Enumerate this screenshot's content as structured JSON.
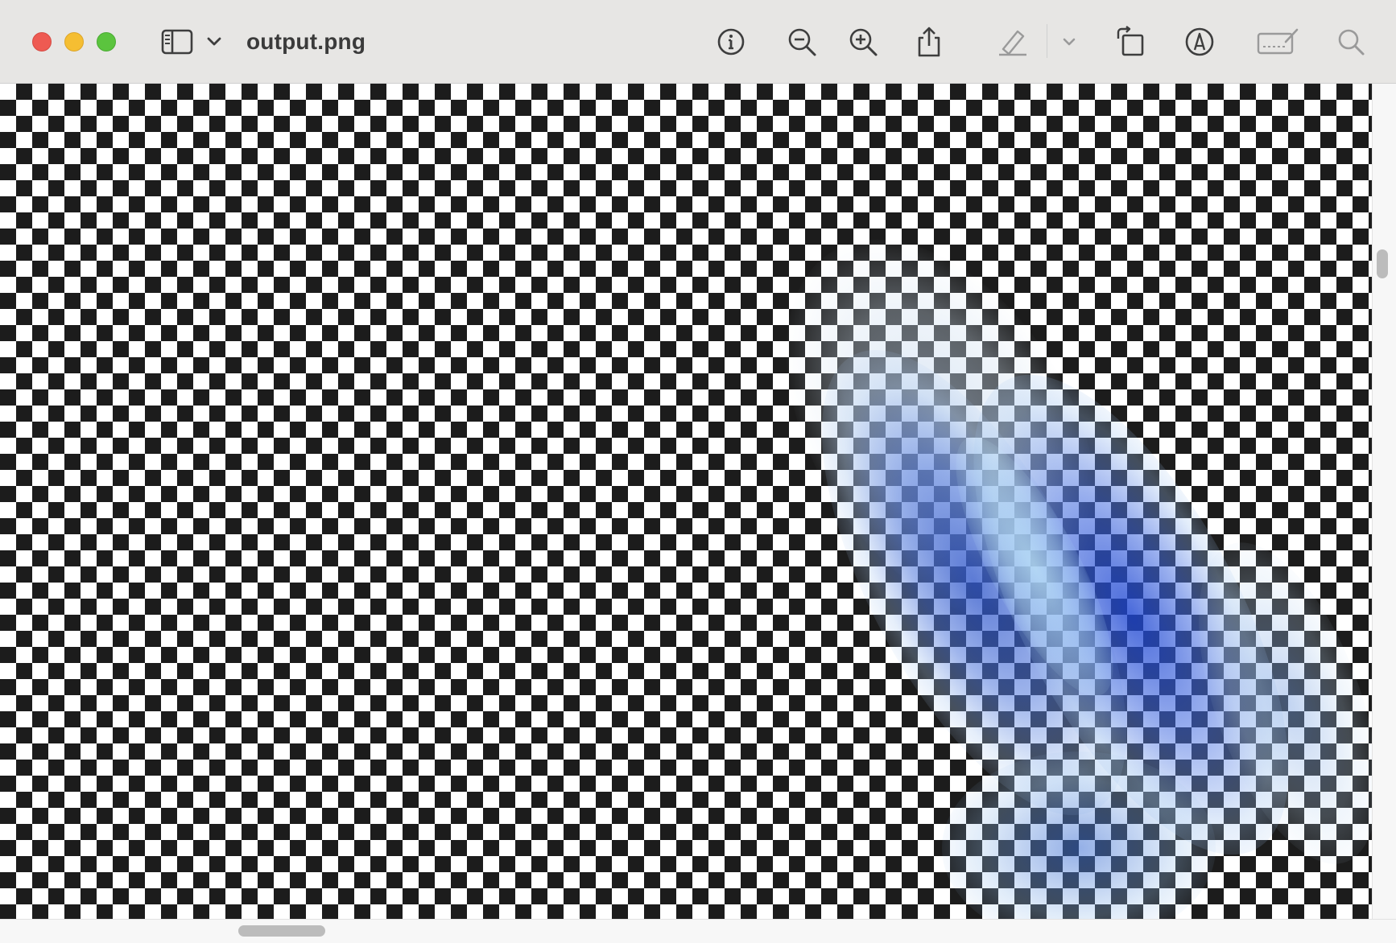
{
  "window": {
    "title": "output.png",
    "controls": [
      "close",
      "minimize",
      "zoom"
    ]
  },
  "toolbar": {
    "items": [
      {
        "name": "sidebar-toggle",
        "icon": "sidebar-icon"
      },
      {
        "name": "sidebar-options",
        "icon": "chevron-down-icon"
      },
      {
        "name": "info",
        "icon": "info-icon"
      },
      {
        "name": "zoom-out",
        "icon": "zoom-out-icon"
      },
      {
        "name": "zoom-in",
        "icon": "zoom-in-icon"
      },
      {
        "name": "share",
        "icon": "share-icon"
      },
      {
        "name": "highlight",
        "icon": "highlighter-icon"
      },
      {
        "name": "highlight-options",
        "icon": "chevron-down-icon"
      },
      {
        "name": "rotate",
        "icon": "rotate-icon"
      },
      {
        "name": "markup",
        "icon": "markup-icon"
      },
      {
        "name": "sign",
        "icon": "signature-icon"
      },
      {
        "name": "search",
        "icon": "search-icon"
      }
    ]
  },
  "image": {
    "background": "transparency-checkerboard",
    "content": "blurred-blue-diagonal-shape",
    "colors": {
      "checker_dark": "#1c1c1c",
      "checker_light": "#ffffff",
      "shape_blue": "#2f57d6",
      "shape_light": "#c9ddf5"
    }
  },
  "colors": {
    "close": "#ee5a52",
    "minimize": "#f5be32",
    "zoom": "#5bc43e",
    "toolbar_bg": "#e7e6e4",
    "icon": "#3e3e3e"
  }
}
